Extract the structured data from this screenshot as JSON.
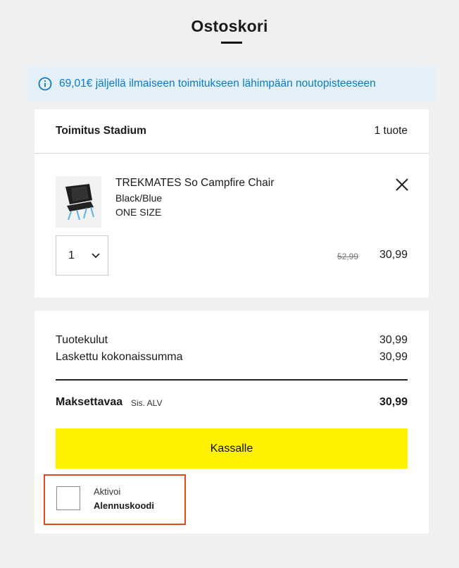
{
  "page": {
    "title": "Ostoskori"
  },
  "banner": {
    "text": "69,01€ jäljellä ilmaiseen toimitukseen lähimpään noutopisteeseen",
    "color": "#0a7ac8",
    "background": "#e4f1fb"
  },
  "delivery": {
    "title": "Toimitus Stadium",
    "count": "1 tuote",
    "item": {
      "name": "TREKMATES So Campfire Chair",
      "color": "Black/Blue",
      "size": "ONE SIZE",
      "quantity": "1",
      "price_old": "52,99",
      "price_new": "30,99",
      "thumbnail_icon": "camping-chair-image"
    }
  },
  "summary": {
    "rows": [
      {
        "label": "Tuotekulut",
        "value": "30,99"
      },
      {
        "label": "Laskettu kokonaissumma",
        "value": "30,99"
      }
    ],
    "total_label": "Maksettavaa",
    "total_vat": "Sis. ALV",
    "total_value": "30,99",
    "checkout_label": "Kassalle",
    "checkout_color": "#fff200"
  },
  "discount": {
    "line1": "Aktivoi",
    "line2": "Alennuskoodi",
    "highlight_color": "#e04a1a"
  }
}
